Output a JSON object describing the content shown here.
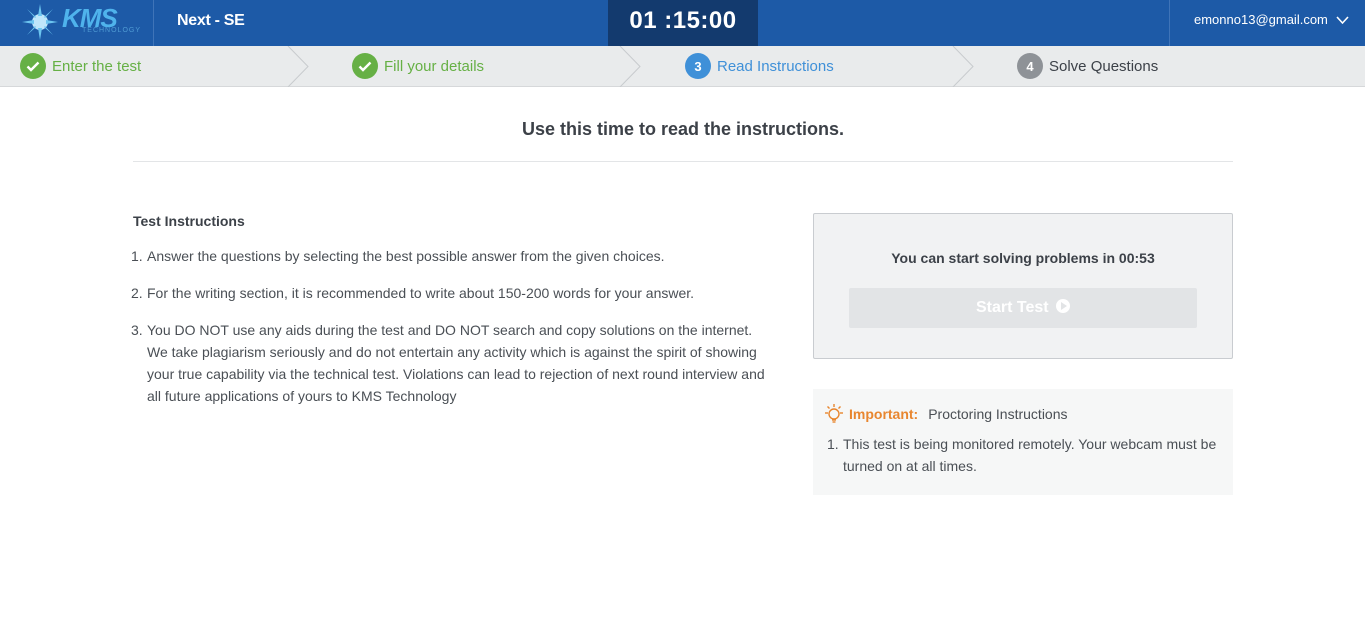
{
  "header": {
    "logo_text": "KMS",
    "logo_sub": "TECHNOLOGY",
    "test_name": "Next - SE",
    "timer": "01 :15:00",
    "user_email": "emonno13@gmail.com"
  },
  "steps": [
    {
      "label": "Enter the test",
      "state": "done",
      "badge": ""
    },
    {
      "label": "Fill your details",
      "state": "done",
      "badge": ""
    },
    {
      "label": "Read Instructions",
      "state": "active",
      "badge": "3"
    },
    {
      "label": "Solve Questions",
      "state": "todo",
      "badge": "4"
    }
  ],
  "main": {
    "heading": "Use this time to read the instructions.",
    "instructions_title": "Test Instructions",
    "instructions": [
      {
        "num": "1.",
        "text": "Answer the questions by selecting the best possible answer from the given choices."
      },
      {
        "num": "2.",
        "text": "For the writing section, it is recommended to write about 150-200 words for your answer."
      },
      {
        "num": "3.",
        "text": "You DO NOT use any aids during the test and DO NOT search and copy solutions on the internet. We take plagiarism seriously and do not entertain any activity which is against the spirit of showing your true capability via the technical test. Violations can lead to rejection of next round interview and all future applications of yours to KMS Technology"
      }
    ]
  },
  "start_panel": {
    "message": "You can start solving problems in 00:53",
    "button_label": "Start Test"
  },
  "important": {
    "label": "Important:",
    "title": "Proctoring Instructions",
    "items": [
      {
        "num": "1.",
        "text": "This test is being monitored remotely. Your webcam must be turned on at all times."
      }
    ]
  },
  "colors": {
    "header_bg": "#1d5aa7",
    "timer_bg": "#133a6e",
    "done_green": "#66b045",
    "active_blue": "#3f90d8",
    "important_orange": "#e8862f"
  }
}
